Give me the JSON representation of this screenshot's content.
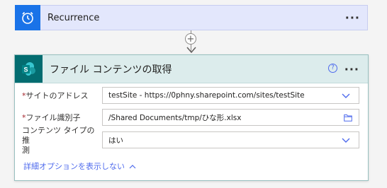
{
  "trigger": {
    "title": "Recurrence",
    "icon": "alarm-clock-icon",
    "more_label": "···",
    "accent": "#1a73e8"
  },
  "connector": {
    "add_label": "+"
  },
  "action": {
    "title": "ファイル コンテンツの取得",
    "icon": "sharepoint-icon",
    "help_label": "?",
    "more_label": "···",
    "accent": "#036c70",
    "fields": [
      {
        "label": "サイトのアドレス",
        "required": "*",
        "value": "testSite - https://0phny.sharepoint.com/sites/testSite",
        "control": "dropdown"
      },
      {
        "label": "ファイル識別子",
        "required": "*",
        "value": "/Shared Documents/tmp/ひな形.xlsx",
        "control": "file-picker"
      },
      {
        "label_line1": "コンテンツ タイプの推",
        "label_line2": "測",
        "value": "はい",
        "control": "dropdown"
      }
    ],
    "advanced_link": "詳細オプションを表示しない"
  }
}
